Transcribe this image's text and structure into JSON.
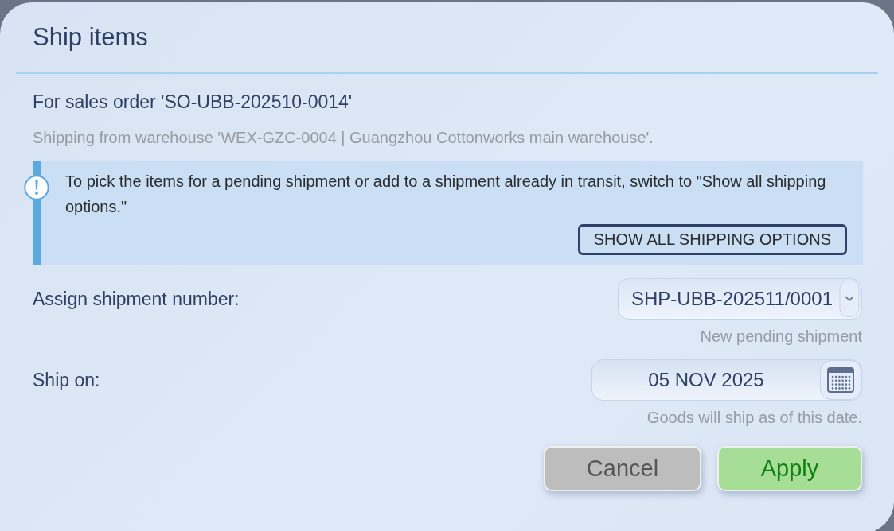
{
  "dialog": {
    "title": "Ship items"
  },
  "order_line": "For sales order 'SO-UBB-202510-0014'",
  "warehouse_line": "Shipping from warehouse 'WEX-GZC-0004 | Guangzhou Cottonworks main warehouse'.",
  "notice": {
    "text": "To pick the items for a pending shipment or add to a shipment already in transit, switch to \"Show all shipping options.\"",
    "button": "SHOW ALL SHIPPING OPTIONS"
  },
  "fields": [
    {
      "kind": "dropdown",
      "label": "Assign shipment number:",
      "value": "SHP-UBB-202511/0001",
      "hint": "New pending shipment"
    },
    {
      "kind": "date",
      "label": "Ship on:",
      "value": "05 NOV 2025",
      "hint": "Goods will ship as of this date."
    }
  ],
  "buttons": [
    {
      "kind": "cancel",
      "label": "Cancel"
    },
    {
      "kind": "apply",
      "label": "Apply"
    }
  ]
}
